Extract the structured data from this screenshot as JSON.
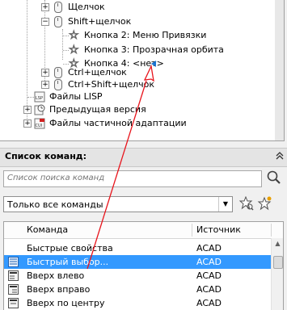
{
  "tree": {
    "items": [
      {
        "label": "Щелчок"
      },
      {
        "label": "Shift+щелчок"
      },
      {
        "label": "Кнопка 2: Меню Привязки"
      },
      {
        "label": "Кнопка 3: Прозрачная орбита"
      },
      {
        "label": "Кнопка 4: <нет>"
      },
      {
        "label": "Ctrl+щелчок"
      },
      {
        "label": "Ctrl+Shift+щелчок"
      },
      {
        "label": "Файлы LISP"
      },
      {
        "label": "Предыдущая версия"
      },
      {
        "label": "Файлы частичной адаптации"
      }
    ]
  },
  "command_list": {
    "title": "Список команд:",
    "search_placeholder": "Список поиска команд",
    "filter_value": "Только все команды",
    "columns": {
      "command": "Команда",
      "source": "Источник"
    },
    "rows": [
      {
        "command": "Быстрые свойства",
        "source": "ACAD",
        "selected": false
      },
      {
        "command": "Быстрый выбор...",
        "source": "ACAD",
        "selected": true
      },
      {
        "command": "Вверх влево",
        "source": "ACAD",
        "selected": false
      },
      {
        "command": "Вверх вправо",
        "source": "ACAD",
        "selected": false
      },
      {
        "command": "Вверх по центру",
        "source": "ACAD",
        "selected": false
      }
    ]
  },
  "colors": {
    "selection": "#3399ff",
    "arrow": "#e8141c",
    "marker": "#1a75d2"
  }
}
